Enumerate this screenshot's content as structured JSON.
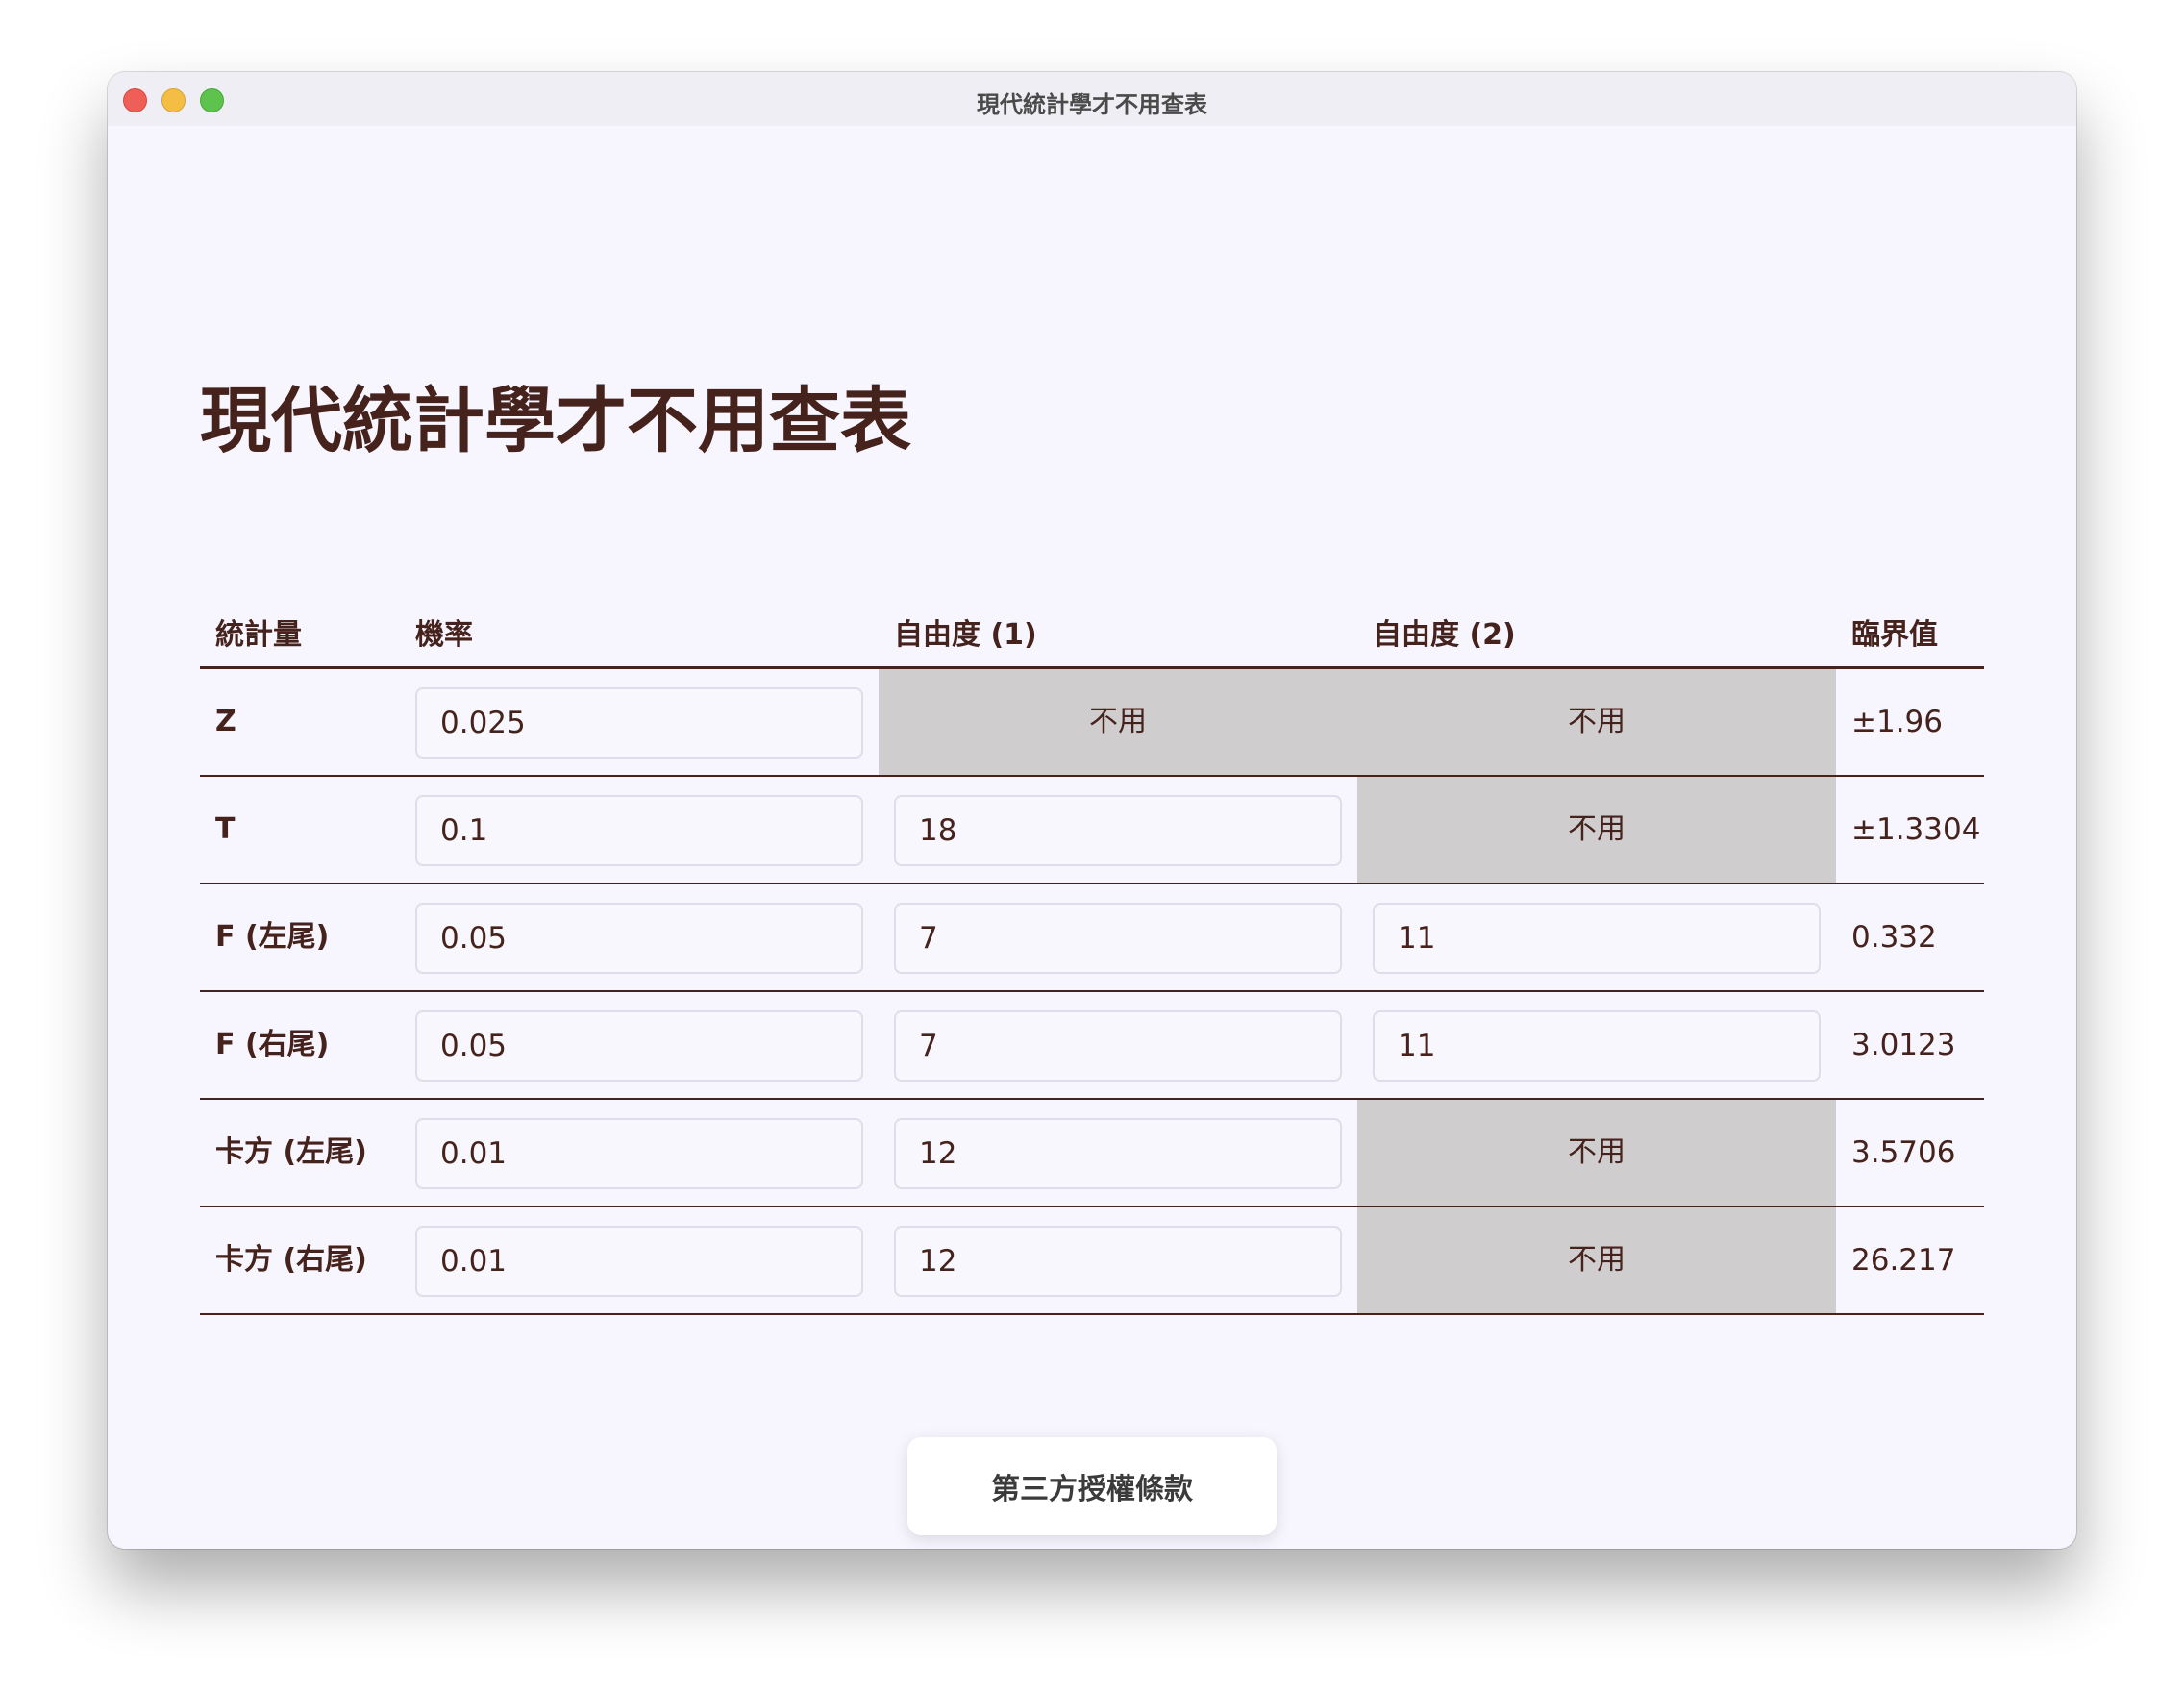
{
  "window": {
    "title": "現代統計學才不用查表"
  },
  "page": {
    "heading": "現代統計學才不用查表"
  },
  "table": {
    "headers": {
      "statistic": "統計量",
      "probability": "機率",
      "df1": "自由度 (1)",
      "df2": "自由度 (2)",
      "critical": "臨界值"
    },
    "disabled_label": "不用",
    "rows": [
      {
        "label": "Z",
        "probability": "0.025",
        "df1": null,
        "df2": null,
        "critical": "±1.96"
      },
      {
        "label": "T",
        "probability": "0.1",
        "df1": "18",
        "df2": null,
        "critical": "±1.3304"
      },
      {
        "label": "F (左尾)",
        "probability": "0.05",
        "df1": "7",
        "df2": "11",
        "critical": "0.332"
      },
      {
        "label": "F (右尾)",
        "probability": "0.05",
        "df1": "7",
        "df2": "11",
        "critical": "3.0123"
      },
      {
        "label": "卡方 (左尾)",
        "probability": "0.01",
        "df1": "12",
        "df2": null,
        "critical": "3.5706"
      },
      {
        "label": "卡方 (右尾)",
        "probability": "0.01",
        "df1": "12",
        "df2": null,
        "critical": "26.217"
      }
    ]
  },
  "footer": {
    "license_button": "第三方授權條款"
  },
  "colors": {
    "text": "#46221c",
    "background": "#f7f5fd",
    "disabled": "#d0cdcf",
    "close": "#ee5f57",
    "minimize": "#f4be45",
    "maximize": "#5ec34d"
  }
}
